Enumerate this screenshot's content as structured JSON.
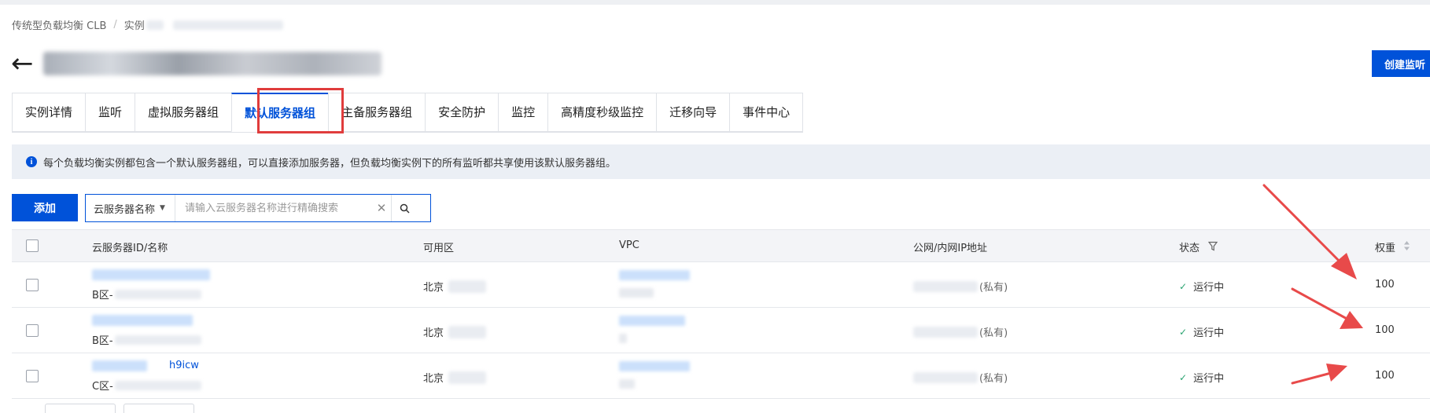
{
  "breadcrumb": {
    "root": "传统型负载均衡 CLB",
    "separator": "/",
    "current": "实例"
  },
  "header": {
    "create_listener": "创建监听"
  },
  "tabs": [
    "实例详情",
    "监听",
    "虚拟服务器组",
    "默认服务器组",
    "主备服务器组",
    "安全防护",
    "监控",
    "高精度秒级监控",
    "迁移向导",
    "事件中心"
  ],
  "active_tab": "默认服务器组",
  "notice": "每个负载均衡实例都包含一个默认服务器组，可以直接添加服务器，但负载均衡实例下的所有监听都共享使用该默认服务器组。",
  "toolbar": {
    "add_label": "添加",
    "filter_field": "云服务器名称",
    "search_placeholder": "请输入云服务器名称进行精确搜索"
  },
  "table": {
    "headers": {
      "name": "云服务器ID/名称",
      "zone": "可用区",
      "vpc": "VPC",
      "ip": "公网/内网IP地址",
      "status": "状态",
      "weight": "权重"
    },
    "rows": [
      {
        "zone_prefix": "B区-",
        "az": "北京",
        "ip_suffix": "(私有)",
        "status": "运行中",
        "weight": "100"
      },
      {
        "zone_prefix": "B区-",
        "az": "北京",
        "ip_suffix": "(私有)",
        "status": "运行中",
        "weight": "100"
      },
      {
        "zone_prefix": "C区-",
        "az": "北京",
        "ip_suffix": "(私有)",
        "status": "运行中",
        "weight": "100",
        "id_partial": "h9icw"
      }
    ]
  },
  "colors": {
    "accent": "#0052d9",
    "annotation": "#e03c3c",
    "success": "#2ba471"
  },
  "icons": {
    "back": "arrow-left-icon",
    "info": "info-icon",
    "search": "search-icon",
    "clear": "close-icon",
    "filter": "filter-icon",
    "sort": "sort-icon",
    "status": "check-icon"
  }
}
